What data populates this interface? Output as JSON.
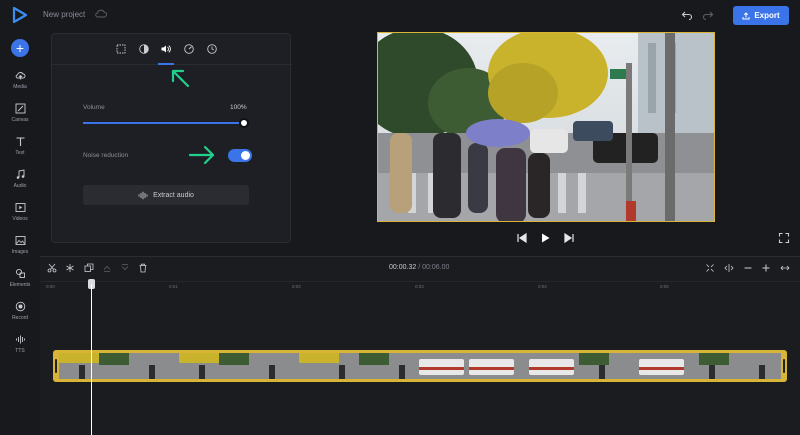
{
  "topbar": {
    "project_title": "New project",
    "export_label": "Export"
  },
  "sidebar": {
    "items": [
      {
        "label": "Media",
        "icon": "cloud-upload-icon"
      },
      {
        "label": "Canvas",
        "icon": "canvas-icon"
      },
      {
        "label": "Text",
        "icon": "text-icon"
      },
      {
        "label": "Audio",
        "icon": "music-note-icon"
      },
      {
        "label": "Videos",
        "icon": "video-icon"
      },
      {
        "label": "Images",
        "icon": "image-icon"
      },
      {
        "label": "Elements",
        "icon": "shapes-icon"
      },
      {
        "label": "Record",
        "icon": "record-icon"
      },
      {
        "label": "TTS",
        "icon": "waveform-icon"
      }
    ]
  },
  "panel": {
    "tabs": [
      "crop-icon",
      "adjust-icon",
      "volume-icon",
      "speed-icon",
      "clock-icon"
    ],
    "active_tab": "volume-icon",
    "volume_label": "Volume",
    "volume_value": "100%",
    "volume_level": 1.0,
    "noise_reduction_label": "Noise reduction",
    "noise_reduction_on": true,
    "extract_audio_label": "Extract audio"
  },
  "timeline": {
    "current_time": "00:00.32",
    "separator": "/",
    "total_time": "00:06.00",
    "ruler_ticks": [
      "0:00",
      "0:01",
      "0:02",
      "0:03",
      "0:04",
      "0:05"
    ]
  },
  "colors": {
    "accent": "#3a74e8",
    "clip_border": "#d8b437",
    "annotation_arrow": "#1fd18b"
  }
}
